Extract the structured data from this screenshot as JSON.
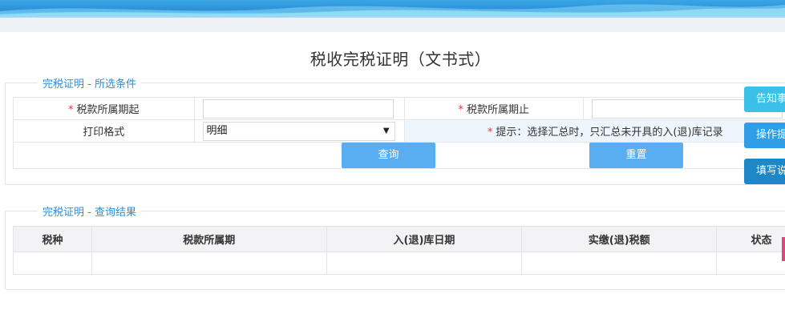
{
  "page_title": "税收完税证明（文书式）",
  "filter_panel": {
    "legend": "完税证明 - 所选条件",
    "tax_period_start_label": "税款所属期起",
    "tax_period_start_value": "",
    "tax_period_end_label": "税款所属期止",
    "tax_period_end_value": "",
    "print_format_label": "打印格式",
    "print_format_value": "明细",
    "hint": "提示：选择汇总时，只汇总未开具的入(退)库记录",
    "query_label": "查询",
    "reset_label": "重置"
  },
  "side_buttons": [
    "告知事",
    "操作提",
    "填写说"
  ],
  "result_panel": {
    "legend": "完税证明 - 查询结果",
    "columns": [
      "税种",
      "税款所属期",
      "入(退)库日期",
      "实缴(退)税额",
      "状态"
    ]
  },
  "colors": {
    "accent": "#2a8fd8",
    "button": "#58aef0",
    "required": "#e03a3a"
  }
}
